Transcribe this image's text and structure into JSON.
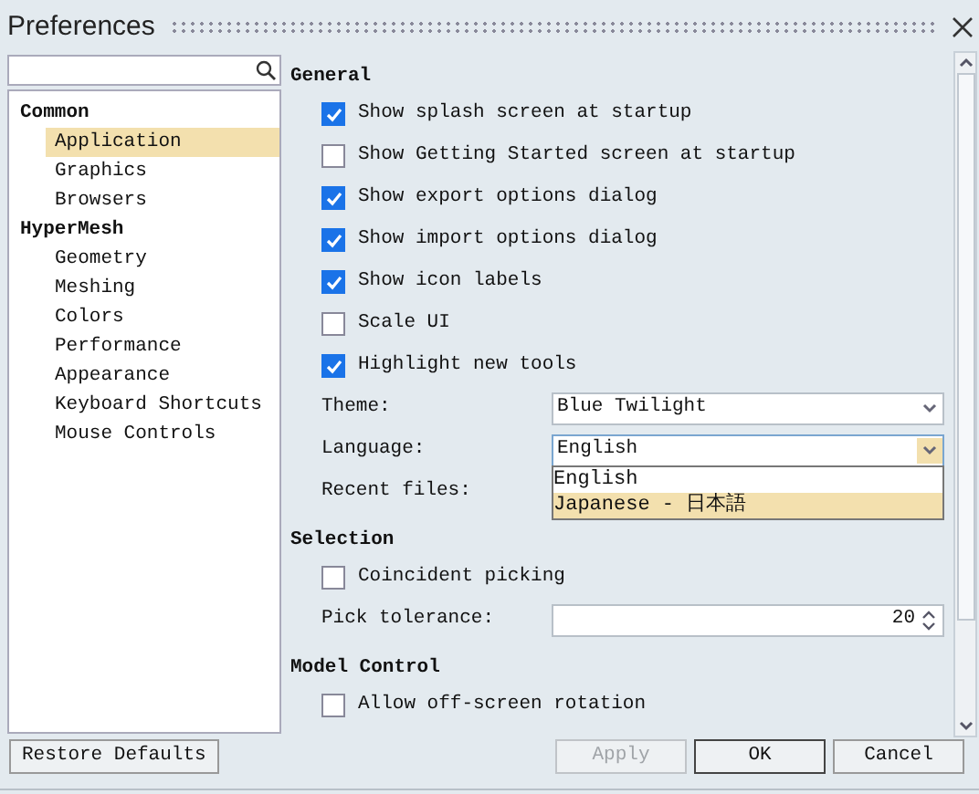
{
  "window": {
    "title": "Preferences"
  },
  "tree": [
    {
      "label": "Common",
      "children": [
        {
          "label": "Application",
          "selected": true
        },
        {
          "label": "Graphics",
          "selected": false
        },
        {
          "label": "Browsers",
          "selected": false
        }
      ]
    },
    {
      "label": "HyperMesh",
      "children": [
        {
          "label": "Geometry",
          "selected": false
        },
        {
          "label": "Meshing",
          "selected": false
        },
        {
          "label": "Colors",
          "selected": false
        },
        {
          "label": "Performance",
          "selected": false
        },
        {
          "label": "Appearance",
          "selected": false
        },
        {
          "label": "Keyboard Shortcuts",
          "selected": false
        },
        {
          "label": "Mouse Controls",
          "selected": false
        }
      ]
    }
  ],
  "sections": [
    {
      "title": "General",
      "items": [
        {
          "kind": "checkbox",
          "label": "Show splash screen at startup",
          "checked": true
        },
        {
          "kind": "checkbox",
          "label": "Show Getting Started screen at startup",
          "checked": false
        },
        {
          "kind": "checkbox",
          "label": "Show export options dialog",
          "checked": true
        },
        {
          "kind": "checkbox",
          "label": "Show import options dialog",
          "checked": true
        },
        {
          "kind": "checkbox",
          "label": "Show icon labels",
          "checked": true
        },
        {
          "kind": "checkbox",
          "label": "Scale UI",
          "checked": false
        },
        {
          "kind": "checkbox",
          "label": "Highlight new tools",
          "checked": true
        },
        {
          "kind": "combo",
          "label": "Theme:",
          "value": "Blue Twilight",
          "open": false
        },
        {
          "kind": "combo",
          "label": "Language:",
          "value": "English",
          "open": true,
          "options": [
            {
              "label": "English",
              "highlighted": false
            },
            {
              "label": "Japanese - 日本語",
              "highlighted": true
            }
          ]
        },
        {
          "kind": "field",
          "label": "Recent files:"
        }
      ]
    },
    {
      "title": "Selection",
      "items": [
        {
          "kind": "checkbox",
          "label": "Coincident picking",
          "checked": false
        },
        {
          "kind": "spin",
          "label": "Pick tolerance:",
          "value": "20"
        }
      ]
    },
    {
      "title": "Model Control",
      "items": [
        {
          "kind": "checkbox",
          "label": "Allow off-screen rotation",
          "checked": false
        }
      ]
    }
  ],
  "buttons": [
    {
      "label": "Restore Defaults",
      "kind": "left",
      "disabled": false
    },
    {
      "label": "Apply",
      "kind": "right",
      "disabled": true
    },
    {
      "label": "OK",
      "kind": "default",
      "disabled": false
    },
    {
      "label": "Cancel",
      "kind": "right",
      "disabled": false
    }
  ]
}
